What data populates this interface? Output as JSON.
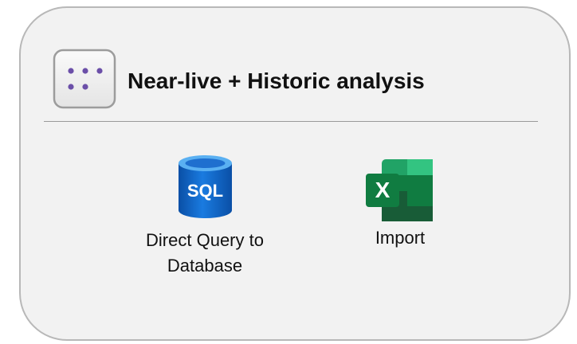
{
  "title": "Near-live + Historic analysis",
  "header_icon": "dots-grid-icon",
  "sources": [
    {
      "icon": "sql-database-icon",
      "icon_text": "SQL",
      "label": "Direct Query to Database"
    },
    {
      "icon": "excel-icon",
      "icon_text": "X",
      "label": "Import"
    }
  ],
  "colors": {
    "card_background": "#f2f2f2",
    "card_border": "#b8b8b8",
    "dots": "#6b4fa8",
    "sql_blue": "#0f6ac9",
    "excel_green": "#1d7a45"
  }
}
